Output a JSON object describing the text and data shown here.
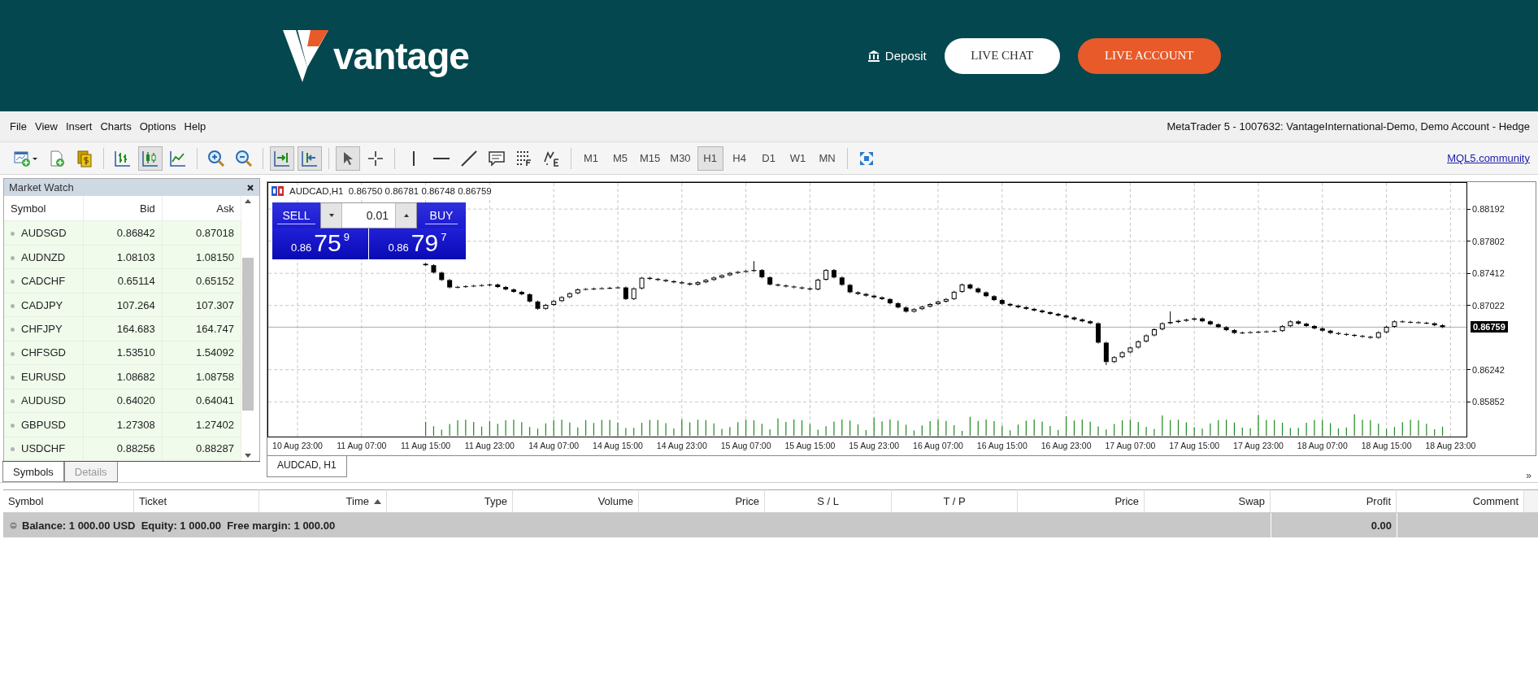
{
  "header": {
    "logo": "vantage",
    "deposit": "Deposit",
    "live_chat": "LIVE CHAT",
    "live_account": "LIVE ACCOUNT"
  },
  "menu": [
    "File",
    "View",
    "Insert",
    "Charts",
    "Options",
    "Help"
  ],
  "window_title": "MetaTrader 5 - 1007632: VantageInternational-Demo, Demo Account - Hedge",
  "toolbar": {
    "tool_groups": [
      [
        {
          "kind": "new-chart",
          "selected": false
        },
        {
          "kind": "new-order",
          "selected": false
        },
        {
          "kind": "coins",
          "selected": false
        }
      ],
      [
        {
          "kind": "bars",
          "selected": false
        },
        {
          "kind": "candles",
          "selected": true
        },
        {
          "kind": "line",
          "selected": false
        }
      ],
      [
        {
          "kind": "zoom-in",
          "selected": false
        },
        {
          "kind": "zoom-out",
          "selected": false
        }
      ],
      [
        {
          "kind": "autoscroll",
          "selected": true
        },
        {
          "kind": "shift",
          "selected": true
        }
      ],
      [
        {
          "kind": "cursor",
          "selected": true
        },
        {
          "kind": "crosshair",
          "selected": false
        }
      ],
      [
        {
          "kind": "vline",
          "selected": false
        },
        {
          "kind": "hline",
          "selected": false
        },
        {
          "kind": "trend",
          "selected": false
        },
        {
          "kind": "text",
          "selected": false
        },
        {
          "kind": "fibo",
          "selected": false
        },
        {
          "kind": "elliott",
          "selected": false
        }
      ]
    ],
    "timeframes": [
      {
        "label": "M1",
        "selected": false
      },
      {
        "label": "M5",
        "selected": false
      },
      {
        "label": "M15",
        "selected": false
      },
      {
        "label": "M30",
        "selected": false
      },
      {
        "label": "H1",
        "selected": true
      },
      {
        "label": "H4",
        "selected": false
      },
      {
        "label": "D1",
        "selected": false
      },
      {
        "label": "W1",
        "selected": false
      },
      {
        "label": "MN",
        "selected": false
      }
    ],
    "community_link": "MQL5.community"
  },
  "market_watch": {
    "title": "Market Watch",
    "columns": [
      "Symbol",
      "Bid",
      "Ask"
    ],
    "rows": [
      {
        "symbol": "AUDSGD",
        "bid": "0.86842",
        "ask": "0.87018"
      },
      {
        "symbol": "AUDNZD",
        "bid": "1.08103",
        "ask": "1.08150"
      },
      {
        "symbol": "CADCHF",
        "bid": "0.65114",
        "ask": "0.65152"
      },
      {
        "symbol": "CADJPY",
        "bid": "107.264",
        "ask": "107.307"
      },
      {
        "symbol": "CHFJPY",
        "bid": "164.683",
        "ask": "164.747"
      },
      {
        "symbol": "CHFSGD",
        "bid": "1.53510",
        "ask": "1.54092"
      },
      {
        "symbol": "EURUSD",
        "bid": "1.08682",
        "ask": "1.08758"
      },
      {
        "symbol": "AUDUSD",
        "bid": "0.64020",
        "ask": "0.64041"
      },
      {
        "symbol": "GBPUSD",
        "bid": "1.27308",
        "ask": "1.27402"
      },
      {
        "symbol": "USDCHF",
        "bid": "0.88256",
        "ask": "0.88287"
      }
    ],
    "tabs": [
      {
        "label": "Symbols",
        "selected": true
      },
      {
        "label": "Details",
        "selected": false
      }
    ]
  },
  "chart": {
    "info": "AUDCAD,H1  0.86750 0.86781 0.86748 0.86759",
    "trade_panel": {
      "sell": "SELL",
      "buy": "BUY",
      "volume": "0.01",
      "sell_price": {
        "prefix": "0.86",
        "big": "75",
        "small": "9"
      },
      "buy_price": {
        "prefix": "0.86",
        "big": "79",
        "small": "7"
      }
    },
    "chart_data": {
      "type": "candlestick",
      "categories": [
        "10 Aug 23:00",
        null,
        null,
        null,
        null,
        null,
        null,
        null,
        "11 Aug 07:00",
        null,
        null,
        null,
        null,
        null,
        null,
        null,
        "11 Aug 15:00",
        null,
        null,
        null,
        null,
        null,
        null,
        null,
        "11 Aug 23:00",
        null,
        null,
        null,
        null,
        null,
        null,
        null,
        "14 Aug 07:00",
        null,
        null,
        null,
        null,
        null,
        null,
        null,
        "14 Aug 15:00",
        null,
        null,
        null,
        null,
        null,
        null,
        null,
        "14 Aug 23:00",
        null,
        null,
        null,
        null,
        null,
        null,
        null,
        "15 Aug 07:00",
        null,
        null,
        null,
        null,
        null,
        null,
        null,
        "15 Aug 15:00",
        null,
        null,
        null,
        null,
        null,
        null,
        null,
        "15 Aug 23:00",
        null,
        null,
        null,
        null,
        null,
        null,
        null,
        "16 Aug 07:00",
        null,
        null,
        null,
        null,
        null,
        null,
        null,
        "16 Aug 15:00",
        null,
        null,
        null,
        null,
        null,
        null,
        null,
        "16 Aug 23:00",
        null,
        null,
        null,
        null,
        null,
        null,
        null,
        "17 Aug 07:00",
        null,
        null,
        null,
        null,
        null,
        null,
        null,
        "17 Aug 15:00",
        null,
        null,
        null,
        null,
        null,
        null,
        null,
        "17 Aug 23:00",
        null,
        null,
        null,
        null,
        null,
        null,
        null,
        "18 Aug 07:00",
        null,
        null,
        null,
        null,
        null,
        null,
        null,
        "18 Aug 15:00",
        null,
        null,
        null,
        null,
        null,
        null,
        null,
        "18 Aug 23:00"
      ],
      "ohlc": [
        null,
        null,
        null,
        null,
        null,
        null,
        null,
        null,
        null,
        null,
        null,
        null,
        null,
        null,
        null,
        null,
        [
          0.87527,
          0.87539,
          0.87499,
          0.87511
        ],
        [
          0.87511,
          0.87523,
          0.87409,
          0.87421
        ],
        [
          0.87421,
          0.87433,
          0.87319,
          0.87331
        ],
        [
          0.87331,
          0.87343,
          0.87229,
          0.87241
        ],
        [
          0.87241,
          0.8726,
          0.87229,
          0.87248
        ],
        [
          0.87248,
          0.87267,
          0.87236,
          0.87255
        ],
        [
          0.87255,
          0.87274,
          0.87243,
          0.87262
        ],
        [
          0.87262,
          0.87281,
          0.8725,
          0.87269
        ],
        [
          0.87269,
          0.87288,
          0.87257,
          0.87276
        ],
        [
          0.87276,
          0.87288,
          0.87234,
          0.87246
        ],
        [
          0.87246,
          0.87258,
          0.87205,
          0.87217
        ],
        [
          0.87217,
          0.87229,
          0.87175,
          0.87187
        ],
        [
          0.87187,
          0.87199,
          0.87146,
          0.87158
        ],
        [
          0.87158,
          0.8717,
          0.87058,
          0.8707
        ],
        [
          0.8707,
          0.87082,
          0.8697,
          0.86982
        ],
        [
          0.86982,
          0.87041,
          0.8697,
          0.87029
        ],
        [
          0.87029,
          0.87088,
          0.87017,
          0.87076
        ],
        [
          0.87076,
          0.87135,
          0.87064,
          0.87123
        ],
        [
          0.87123,
          0.87182,
          0.87111,
          0.8717
        ],
        [
          0.8717,
          0.87229,
          0.87158,
          0.87217
        ],
        [
          0.87217,
          0.87234,
          0.87205,
          0.87222
        ],
        [
          0.87222,
          0.87239,
          0.8721,
          0.87227
        ],
        [
          0.87227,
          0.87243,
          0.87215,
          0.87231
        ],
        [
          0.87231,
          0.87248,
          0.87219,
          0.87236
        ],
        [
          0.87236,
          0.87253,
          0.87224,
          0.87241
        ],
        [
          0.87241,
          0.87253,
          0.87088,
          0.871
        ],
        [
          0.871,
          0.87241,
          0.87088,
          0.87229
        ],
        [
          0.87229,
          0.8737,
          0.87217,
          0.87358
        ],
        [
          0.87358,
          0.8737,
          0.87332,
          0.87344
        ],
        [
          0.87344,
          0.87356,
          0.87319,
          0.87331
        ],
        [
          0.87331,
          0.87343,
          0.87305,
          0.87317
        ],
        [
          0.87317,
          0.87329,
          0.87291,
          0.87303
        ],
        [
          0.87303,
          0.87315,
          0.87278,
          0.8729
        ],
        [
          0.8729,
          0.87302,
          0.87264,
          0.87276
        ],
        [
          0.87276,
          0.87316,
          0.87264,
          0.87304
        ],
        [
          0.87304,
          0.87344,
          0.87292,
          0.87332
        ],
        [
          0.87332,
          0.87373,
          0.8732,
          0.87361
        ],
        [
          0.87361,
          0.87401,
          0.87349,
          0.87389
        ],
        [
          0.87389,
          0.87429,
          0.87377,
          0.87417
        ],
        [
          0.87417,
          0.87441,
          0.87405,
          0.87429
        ],
        [
          0.87429,
          0.87452,
          0.87417,
          0.8744
        ],
        [
          0.8744,
          0.8756,
          0.87428,
          0.87452
        ],
        [
          0.87452,
          0.87464,
          0.87352,
          0.87364
        ],
        [
          0.87364,
          0.87376,
          0.87264,
          0.87276
        ],
        [
          0.87276,
          0.87288,
          0.87252,
          0.87264
        ],
        [
          0.87264,
          0.87276,
          0.8724,
          0.87252
        ],
        [
          0.87252,
          0.87264,
          0.87229,
          0.87241
        ],
        [
          0.87241,
          0.87253,
          0.87217,
          0.87229
        ],
        [
          0.87229,
          0.87241,
          0.87205,
          0.87217
        ],
        [
          0.87217,
          0.87347,
          0.87205,
          0.87335
        ],
        [
          0.87335,
          0.87464,
          0.87323,
          0.87452
        ],
        [
          0.87452,
          0.87464,
          0.8735,
          0.87362
        ],
        [
          0.87362,
          0.87374,
          0.8726,
          0.87272
        ],
        [
          0.87272,
          0.87284,
          0.8717,
          0.87182
        ],
        [
          0.87182,
          0.87194,
          0.8715,
          0.87162
        ],
        [
          0.87162,
          0.87174,
          0.87129,
          0.87141
        ],
        [
          0.87141,
          0.87153,
          0.87109,
          0.87121
        ],
        [
          0.87121,
          0.87133,
          0.87088,
          0.871
        ],
        [
          0.871,
          0.87112,
          0.87037,
          0.87049
        ],
        [
          0.87049,
          0.87061,
          0.86986,
          0.86998
        ],
        [
          0.86998,
          0.8701,
          0.86935,
          0.86947
        ],
        [
          0.86947,
          0.8699,
          0.86935,
          0.86978
        ],
        [
          0.86978,
          0.8702,
          0.86966,
          0.87008
        ],
        [
          0.87008,
          0.87051,
          0.86996,
          0.87039
        ],
        [
          0.87039,
          0.87081,
          0.87027,
          0.87069
        ],
        [
          0.87069,
          0.87112,
          0.87057,
          0.871
        ],
        [
          0.871,
          0.872,
          0.87088,
          0.87188
        ],
        [
          0.87188,
          0.87288,
          0.87176,
          0.87276
        ],
        [
          0.87276,
          0.87288,
          0.87217,
          0.87229
        ],
        [
          0.87229,
          0.87241,
          0.8717,
          0.87182
        ],
        [
          0.87182,
          0.87194,
          0.87123,
          0.87135
        ],
        [
          0.87135,
          0.87147,
          0.87076,
          0.87088
        ],
        [
          0.87088,
          0.871,
          0.87029,
          0.87041
        ],
        [
          0.87041,
          0.87053,
          0.87009,
          0.87021
        ],
        [
          0.87021,
          0.87033,
          0.86989,
          0.87001
        ],
        [
          0.87001,
          0.87013,
          0.86969,
          0.86981
        ],
        [
          0.86981,
          0.86993,
          0.86949,
          0.86961
        ],
        [
          0.86961,
          0.86973,
          0.86928,
          0.8694
        ],
        [
          0.8694,
          0.86952,
          0.86908,
          0.8692
        ],
        [
          0.8692,
          0.86932,
          0.86888,
          0.869
        ],
        [
          0.869,
          0.86912,
          0.86865,
          0.86877
        ],
        [
          0.86877,
          0.86889,
          0.86841,
          0.86853
        ],
        [
          0.86853,
          0.86865,
          0.86818,
          0.8683
        ],
        [
          0.8683,
          0.86842,
          0.86794,
          0.86806
        ],
        [
          0.86806,
          0.86818,
          0.86559,
          0.86571
        ],
        [
          0.86571,
          0.86583,
          0.863,
          0.86336
        ],
        [
          0.86336,
          0.86407,
          0.86324,
          0.86395
        ],
        [
          0.86395,
          0.86465,
          0.86383,
          0.86453
        ],
        [
          0.86453,
          0.86524,
          0.86441,
          0.86512
        ],
        [
          0.86512,
          0.86598,
          0.865,
          0.86586
        ],
        [
          0.86586,
          0.86671,
          0.86574,
          0.86659
        ],
        [
          0.86659,
          0.86745,
          0.86647,
          0.86733
        ],
        [
          0.86733,
          0.86818,
          0.86721,
          0.86806
        ],
        [
          0.86806,
          0.8695,
          0.86794,
          0.86821
        ],
        [
          0.86821,
          0.86848,
          0.86809,
          0.86836
        ],
        [
          0.86836,
          0.86862,
          0.86824,
          0.8685
        ],
        [
          0.8685,
          0.86877,
          0.86838,
          0.86865
        ],
        [
          0.86865,
          0.86877,
          0.86818,
          0.8683
        ],
        [
          0.8683,
          0.86842,
          0.86782,
          0.86794
        ],
        [
          0.86794,
          0.86806,
          0.86747,
          0.86759
        ],
        [
          0.86759,
          0.86771,
          0.86711,
          0.86723
        ],
        [
          0.86723,
          0.86735,
          0.86676,
          0.86688
        ],
        [
          0.86688,
          0.86705,
          0.86676,
          0.86693
        ],
        [
          0.86693,
          0.8671,
          0.86681,
          0.86698
        ],
        [
          0.86698,
          0.86714,
          0.86686,
          0.86702
        ],
        [
          0.86702,
          0.86719,
          0.8669,
          0.86707
        ],
        [
          0.86707,
          0.86724,
          0.86695,
          0.86712
        ],
        [
          0.86712,
          0.86783,
          0.867,
          0.86771
        ],
        [
          0.86771,
          0.86841,
          0.86759,
          0.86829
        ],
        [
          0.86829,
          0.86841,
          0.86789,
          0.86801
        ],
        [
          0.86801,
          0.86813,
          0.86761,
          0.86773
        ],
        [
          0.86773,
          0.86785,
          0.86732,
          0.86744
        ],
        [
          0.86744,
          0.86756,
          0.86704,
          0.86716
        ],
        [
          0.86716,
          0.86728,
          0.86676,
          0.86688
        ],
        [
          0.86688,
          0.867,
          0.86664,
          0.86676
        ],
        [
          0.86676,
          0.86688,
          0.86653,
          0.86665
        ],
        [
          0.86665,
          0.86677,
          0.86641,
          0.86653
        ],
        [
          0.86653,
          0.86665,
          0.8663,
          0.86642
        ],
        [
          0.86642,
          0.86654,
          0.86618,
          0.8663
        ],
        [
          0.8663,
          0.86708,
          0.86618,
          0.86696
        ],
        [
          0.86696,
          0.86775,
          0.86684,
          0.86763
        ],
        [
          0.86763,
          0.86841,
          0.86751,
          0.86829
        ],
        [
          0.86829,
          0.86841,
          0.86811,
          0.86823
        ],
        [
          0.86823,
          0.86835,
          0.86806,
          0.86818
        ],
        [
          0.86818,
          0.8683,
          0.868,
          0.86812
        ],
        [
          0.86812,
          0.86824,
          0.86794,
          0.86806
        ],
        [
          0.86806,
          0.86818,
          0.8677,
          0.86782
        ],
        [
          0.86782,
          0.86794,
          0.86747,
          0.86759
        ],
        null
      ],
      "ylim": [
        0.85431,
        0.88509
      ],
      "grid": true,
      "ref_lines": [
        {
          "axis": "y",
          "value": 0.86759,
          "label": "0.86759"
        }
      ],
      "yticks": [
        {
          "value": 0.88192,
          "label": "0.88192"
        },
        {
          "value": 0.87802,
          "label": "0.87802"
        },
        {
          "value": 0.87412,
          "label": "0.87412"
        },
        {
          "value": 0.87022,
          "label": "0.87022"
        },
        {
          "value": 0.86242,
          "label": "0.86242"
        },
        {
          "value": 0.85852,
          "label": "0.85852"
        }
      ]
    },
    "tab": "AUDCAD, H1"
  },
  "trade": {
    "more": "»",
    "columns": [
      {
        "label": "Symbol"
      },
      {
        "label": "Ticket"
      },
      {
        "label": "Time",
        "sorted": true
      },
      {
        "label": "Type"
      },
      {
        "label": "Volume"
      },
      {
        "label": "Price"
      },
      {
        "label": "S / L"
      },
      {
        "label": "T / P"
      },
      {
        "label": "Price"
      },
      {
        "label": "Swap"
      },
      {
        "label": "Profit"
      },
      {
        "label": "Comment"
      }
    ],
    "balance_row": {
      "summary": "Balance: 1 000.00 USD  Equity: 1 000.00  Free margin: 1 000.00",
      "profit": "0.00"
    }
  }
}
